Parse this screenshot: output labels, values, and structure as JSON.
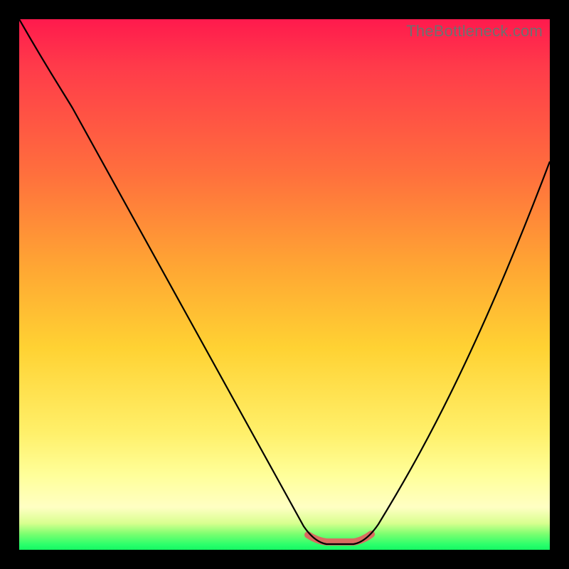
{
  "watermark": "TheBottleneck.com",
  "colors": {
    "gradient_top": "#ff1a4d",
    "gradient_mid": "#ffd233",
    "gradient_bottom": "#15f763",
    "curve": "#000000",
    "highlight": "#d96c60",
    "frame": "#000000"
  },
  "chart_data": {
    "type": "line",
    "title": "",
    "xlabel": "",
    "ylabel": "",
    "xlim": [
      0,
      100
    ],
    "ylim": [
      0,
      100
    ],
    "x": [
      0,
      5,
      10,
      15,
      20,
      25,
      30,
      35,
      40,
      45,
      50,
      55,
      58,
      60,
      62,
      65,
      70,
      75,
      80,
      85,
      90,
      95,
      100
    ],
    "values": [
      100,
      92,
      82,
      73,
      63,
      54,
      44,
      35,
      26,
      17,
      8,
      2,
      0.5,
      0,
      0.5,
      2,
      8,
      17,
      27,
      38,
      49,
      61,
      74
    ],
    "highlight_range_x": [
      55,
      65
    ],
    "description": "V-shaped bottleneck curve. Left branch nearly linear from top-left; right branch convex rising to ~74% at right edge. Minimum ~0 at x≈60. Short salmon segment highlights the flat valley floor."
  }
}
